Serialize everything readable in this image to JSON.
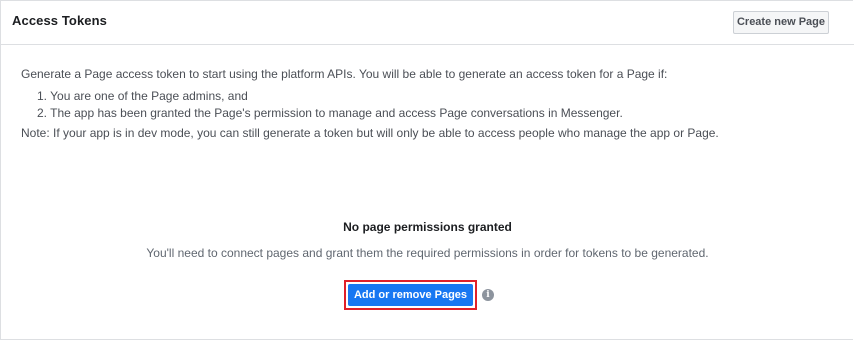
{
  "header": {
    "title": "Access Tokens",
    "create_button_label": "Create new Page"
  },
  "intro": {
    "lead": "Generate a Page access token to start using the platform APIs. You will be able to generate an access token for a Page if:",
    "conditions": [
      "1. You are one of the Page admins, and",
      "2. The app has been granted the Page's permission to manage and access Page conversations in Messenger."
    ],
    "note": "Note: If your app is in dev mode, you can still generate a token but will only be able to access people who manage the app or Page."
  },
  "empty_state": {
    "title": "No page permissions granted",
    "message": "You'll need to connect pages and grant them the required permissions in order for tokens to be generated.",
    "button_label": "Add or remove Pages",
    "info_icon": "info-icon",
    "info_glyph": "i"
  },
  "colors": {
    "primary_button": "#1877f2",
    "highlight_border": "#e0202a",
    "info_icon": "#8d949e"
  }
}
